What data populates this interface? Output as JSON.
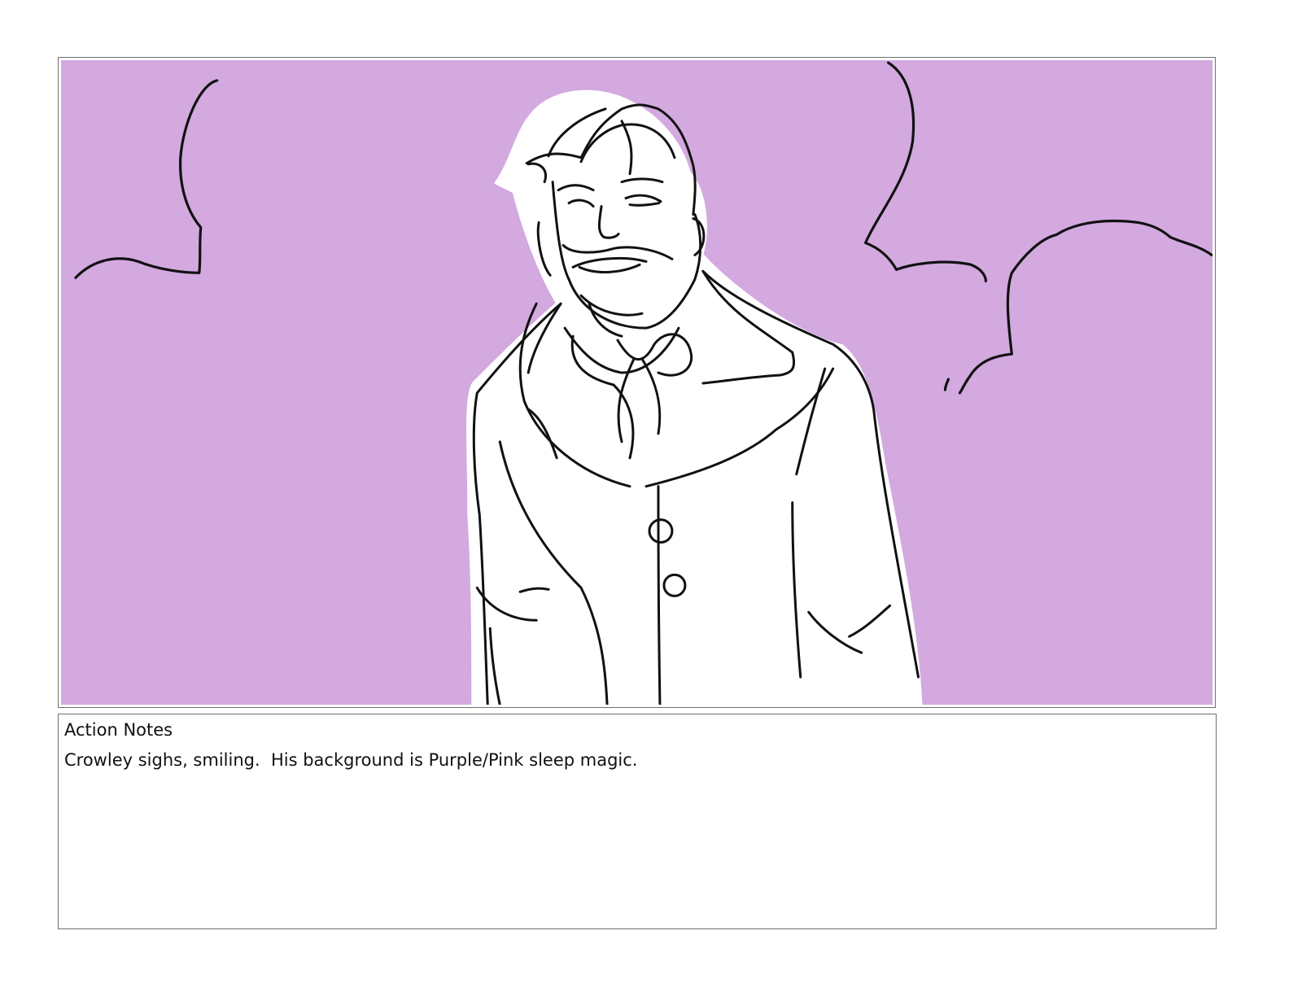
{
  "panel": {
    "background_color": "#d3a9e0",
    "line_color": "#111111",
    "figure_fill": "#ffffff",
    "image_subject": "crowley-sketch"
  },
  "notes": {
    "title": "Action Notes",
    "text": "Crowley sighs, smiling.  His background is Purple/Pink sleep magic."
  }
}
